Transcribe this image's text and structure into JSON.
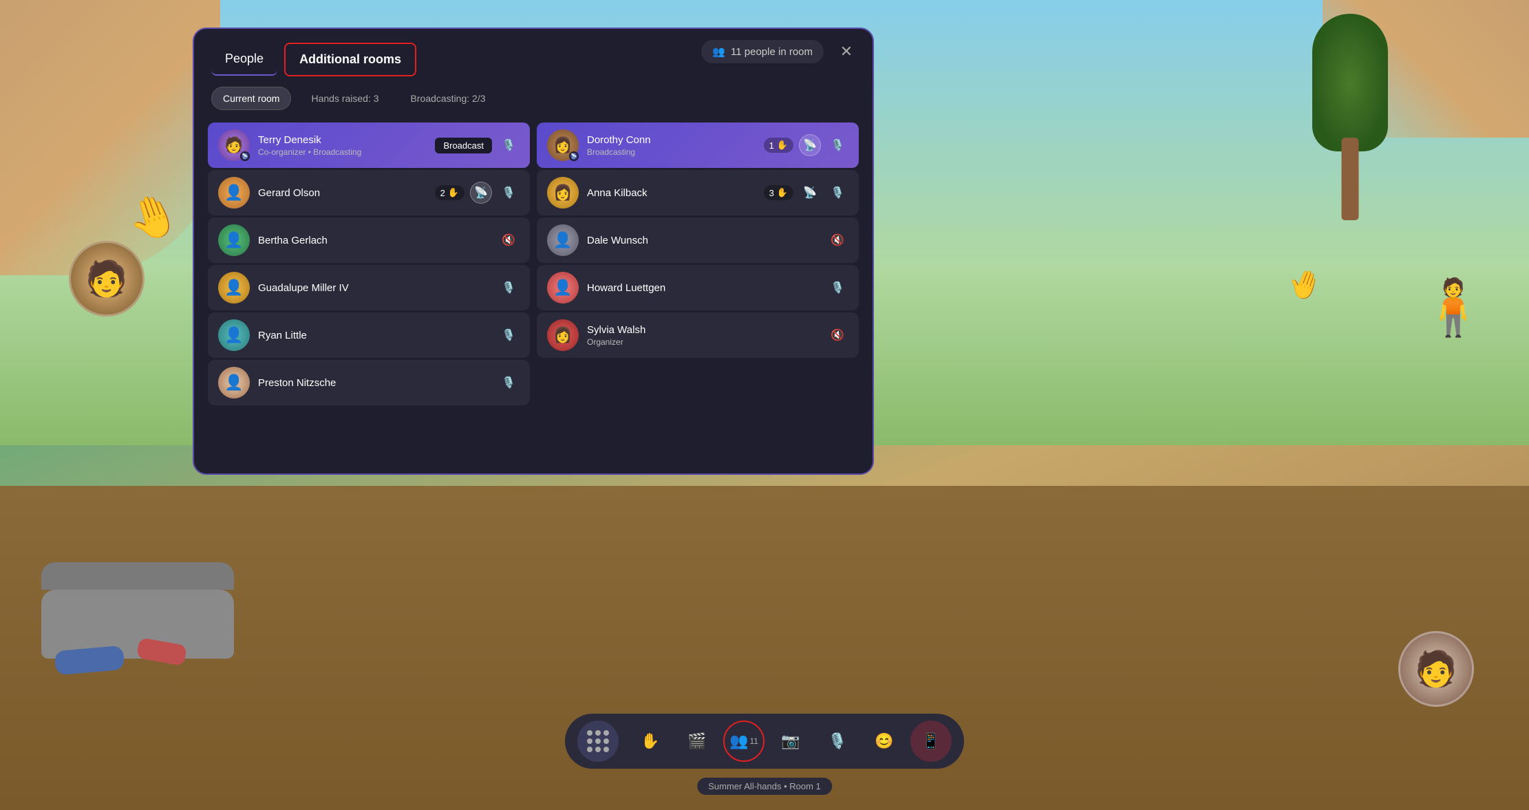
{
  "background": {
    "scene": "virtual meeting room with outdoor view"
  },
  "panel": {
    "tabs": [
      {
        "id": "people",
        "label": "People",
        "active": false
      },
      {
        "id": "additional-rooms",
        "label": "Additional rooms",
        "active": true,
        "highlighted": true
      }
    ],
    "people_count": "11 people in room",
    "people_count_icon": "👥",
    "close_icon": "✕"
  },
  "filters": [
    {
      "id": "current-room",
      "label": "Current room",
      "active": true
    },
    {
      "id": "hands-raised",
      "label": "Hands raised: 3",
      "active": false
    },
    {
      "id": "broadcasting",
      "label": "Broadcasting: 2/3",
      "active": false
    }
  ],
  "participants": {
    "left_column": [
      {
        "id": "terry-denesik",
        "name": "Terry Denesik",
        "role": "Co-organizer • Broadcasting",
        "avatar_color": "av-purple",
        "avatar_emoji": "🧑",
        "broadcasting": true,
        "show_broadcast_badge": true,
        "broadcast_badge_label": "Broadcast",
        "mic_icon": "🎙️",
        "mic_muted": false
      },
      {
        "id": "gerard-olson",
        "name": "Gerard Olson",
        "role": "",
        "avatar_color": "av-orange",
        "avatar_emoji": "👤",
        "broadcasting": false,
        "hands": "2",
        "show_broadcast_icon": true,
        "mic_muted": false
      },
      {
        "id": "bertha-gerlach",
        "name": "Bertha Gerlach",
        "role": "",
        "avatar_color": "av-green",
        "avatar_emoji": "👤",
        "broadcasting": false,
        "mic_muted": true
      },
      {
        "id": "guadalupe-miller",
        "name": "Guadalupe Miller IV",
        "role": "",
        "avatar_color": "av-yellow",
        "avatar_emoji": "👤",
        "broadcasting": false,
        "mic_muted": false
      },
      {
        "id": "ryan-little",
        "name": "Ryan Little",
        "role": "",
        "avatar_color": "av-teal",
        "avatar_emoji": "👤",
        "broadcasting": false,
        "mic_muted": false
      },
      {
        "id": "preston-nitzsche",
        "name": "Preston Nitzsche",
        "role": "",
        "avatar_color": "av-cream",
        "avatar_emoji": "👤",
        "broadcasting": false,
        "mic_muted": false
      }
    ],
    "right_column": [
      {
        "id": "dorothy-conn",
        "name": "Dorothy Conn",
        "role": "Broadcasting",
        "avatar_color": "av-brown",
        "avatar_emoji": "👩",
        "broadcasting": true,
        "hands": "1",
        "show_broadcast_icon": true,
        "mic_muted": false
      },
      {
        "id": "anna-kilback",
        "name": "Anna Kilback",
        "role": "",
        "avatar_color": "av-yellow",
        "avatar_emoji": "👩",
        "broadcasting": false,
        "hands": "3",
        "show_broadcast_icon": true,
        "mic_muted": false
      },
      {
        "id": "dale-wunsch",
        "name": "Dale Wunsch",
        "role": "",
        "avatar_color": "av-gray",
        "avatar_emoji": "👤",
        "broadcasting": false,
        "mic_muted": true
      },
      {
        "id": "howard-luettgen",
        "name": "Howard Luettgen",
        "role": "",
        "avatar_color": "av-pink",
        "avatar_emoji": "👤",
        "broadcasting": false,
        "mic_muted": false
      },
      {
        "id": "sylvia-walsh",
        "name": "Sylvia Walsh",
        "role": "Organizer",
        "avatar_color": "av-red",
        "avatar_emoji": "👩",
        "broadcasting": false,
        "mic_muted": true
      }
    ]
  },
  "toolbar": {
    "apps_icon": "⋯",
    "raise_hand_label": "✋",
    "camera_label": "📷",
    "people_label": "👥",
    "people_count": "11",
    "camera2_label": "📷",
    "mic_label": "🎙️",
    "emoji_label": "😊",
    "share_label": "📱",
    "highlighted": "people"
  },
  "status_bar": {
    "text": "Summer All-hands • Room 1"
  }
}
